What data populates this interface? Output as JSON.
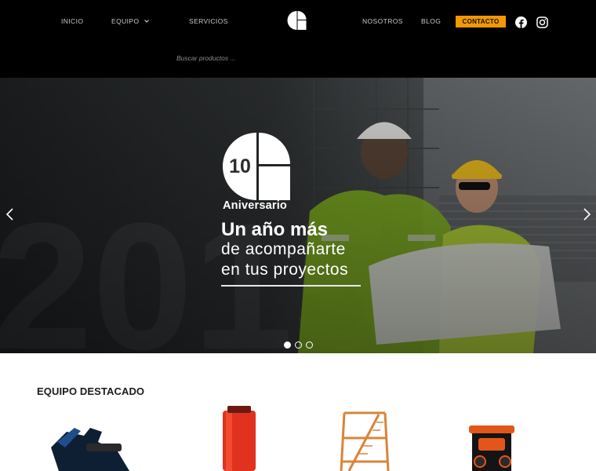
{
  "nav": {
    "inicio": "INICIO",
    "equipo": "EQUIPO",
    "servicios": "SERVICIOS",
    "nosotros": "NOSOTROS",
    "blog": "BLOG",
    "contacto": "CONTACTO"
  },
  "icons": {
    "dropdown": "chevron-down-icon",
    "facebook": "facebook-icon",
    "instagram": "instagram-icon",
    "prev": "chevron-left-icon",
    "next": "chevron-right-icon"
  },
  "colors": {
    "accent": "#f39800",
    "header_bg": "#000000"
  },
  "search": {
    "placeholder": "Buscar productos ..."
  },
  "hero": {
    "badge_number": "10",
    "badge_label": "Aniversario",
    "headline_1": "Un año más",
    "headline_2": "de acompañarte",
    "headline_3": "en tus proyectos",
    "background_text": "2015",
    "slides_count": 3,
    "active_slide": 1
  },
  "featured": {
    "title": "EQUIPO DESTACADO",
    "items": [
      "jackhammer",
      "core-drill",
      "scaffold",
      "pressure-washer"
    ]
  }
}
